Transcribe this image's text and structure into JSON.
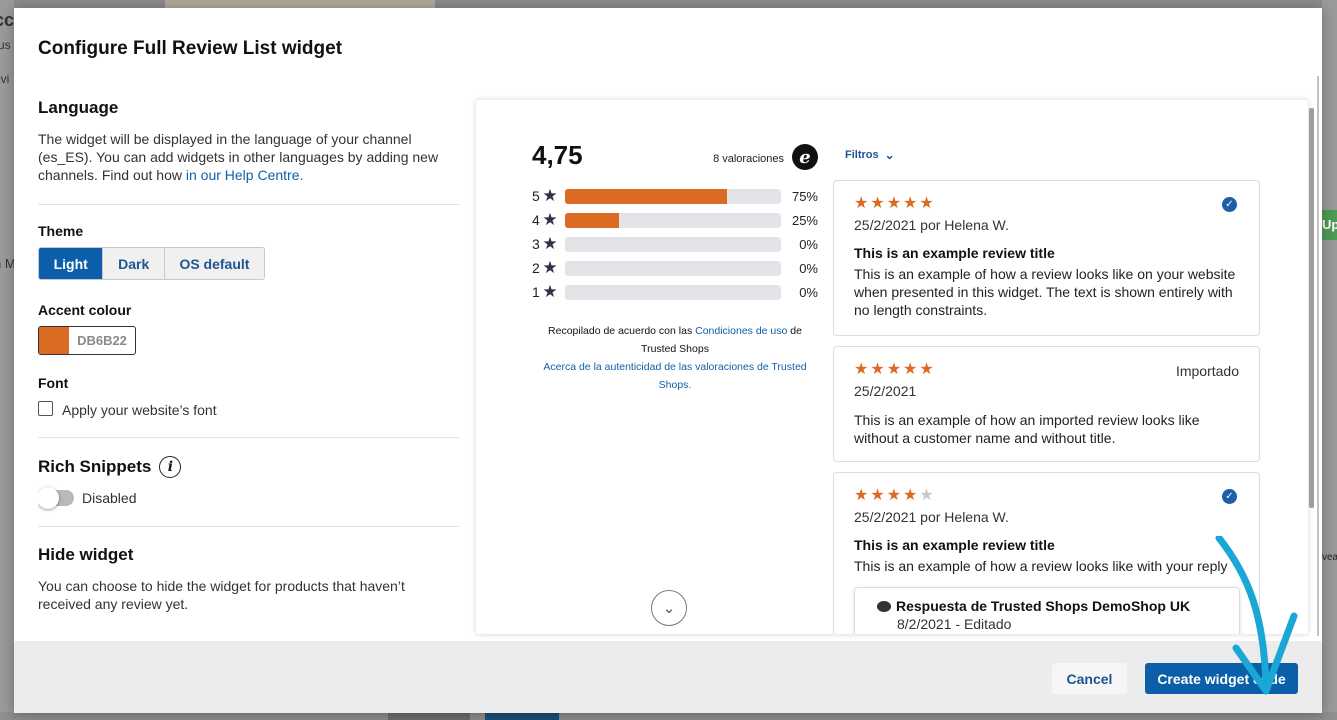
{
  "modal": {
    "title": "Configure Full Review List widget"
  },
  "language": {
    "heading": "Language",
    "text": "The widget will be displayed in the language of your channel (es_ES). You can add widgets in other languages by adding new channels. Find out how ",
    "link": "in our Help Centre."
  },
  "theme": {
    "label": "Theme",
    "options": [
      "Light",
      "Dark",
      "OS default"
    ],
    "selected": "Light"
  },
  "accent": {
    "label": "Accent colour",
    "value": "DB6B22",
    "color": "#DB6B22"
  },
  "font": {
    "label": "Font",
    "checkbox_label": "Apply your website’s font",
    "checked": false
  },
  "rich_snippets": {
    "heading": "Rich Snippets",
    "info_icon": "i",
    "toggle_label": "Disabled",
    "enabled": false
  },
  "hide_widget": {
    "heading": "Hide widget",
    "text": "You can choose to hide the widget for products that haven’t received any review yet."
  },
  "preview": {
    "score": "4,75",
    "count": "8 valoraciones",
    "logo": "e",
    "distribution": [
      {
        "stars": "5",
        "fraction": 0.75,
        "pct": "75%"
      },
      {
        "stars": "4",
        "fraction": 0.25,
        "pct": "25%"
      },
      {
        "stars": "3",
        "fraction": 0,
        "pct": "0%"
      },
      {
        "stars": "2",
        "fraction": 0,
        "pct": "0%"
      },
      {
        "stars": "1",
        "fraction": 0,
        "pct": "0%"
      }
    ],
    "source_text_1": "Recopilado de acuerdo con las ",
    "source_link_1": "Condiciones de uso",
    "source_text_2": " de Trusted Shops",
    "source_link_2": "Acerca de la autenticidad de las valoraciones de Trusted Shops.",
    "filters": "Filtros",
    "reviews": [
      {
        "rating": 5,
        "date": "25/2/2021 por Helena W.",
        "title": "This is an example review title",
        "text": "This is an example of how a review looks like on your website when presented in this widget. The text is shown entirely with no length constraints.",
        "verified": true
      },
      {
        "rating": 5,
        "date": "25/2/2021",
        "badge": "Importado",
        "text": "This is an example of how an imported review looks like without a customer name and without title."
      },
      {
        "rating": 4,
        "date": "25/2/2021 por Helena W.",
        "title": "This is an example review title",
        "text": "This is an example of how a review looks like with your reply",
        "verified": true,
        "reply": {
          "author": "Respuesta de Trusted Shops DemoShop UK",
          "date": "8/2/2021 - Editado"
        }
      }
    ]
  },
  "footer": {
    "cancel": "Cancel",
    "create": "Create widget code"
  },
  "background": {
    "left_fragments": [
      "cc",
      "rus",
      "evi",
      "n M"
    ],
    "right_button": "Up",
    "right_fragment": "vea"
  },
  "colors": {
    "primary": "#0a5fa8",
    "accent": "#DB6B22",
    "arrow": "#1aa7d6"
  }
}
